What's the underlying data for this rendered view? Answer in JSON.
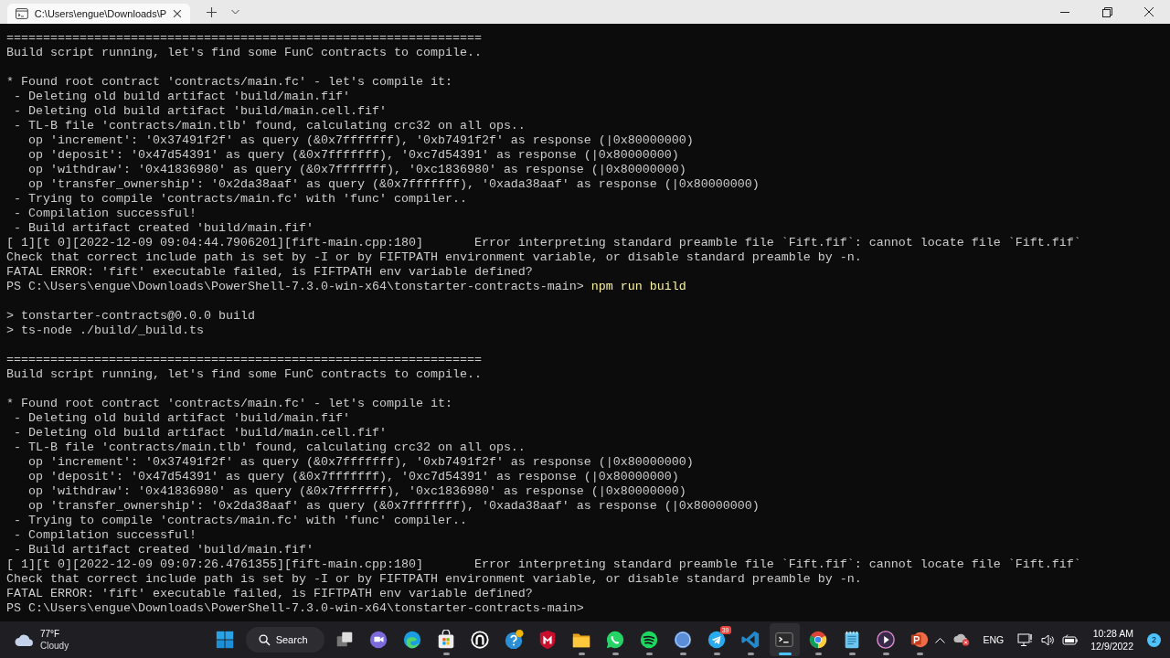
{
  "window": {
    "tab_title": "C:\\Users\\engue\\Downloads\\P"
  },
  "terminal": {
    "lines": [
      {
        "kind": "text",
        "text": "================================================================="
      },
      {
        "kind": "text",
        "text": "Build script running, let's find some FunC contracts to compile.."
      },
      {
        "kind": "blank"
      },
      {
        "kind": "text",
        "text": "* Found root contract 'contracts/main.fc' - let's compile it:"
      },
      {
        "kind": "text",
        "text": " - Deleting old build artifact 'build/main.fif'"
      },
      {
        "kind": "text",
        "text": " - Deleting old build artifact 'build/main.cell.fif'"
      },
      {
        "kind": "text",
        "text": " - TL-B file 'contracts/main.tlb' found, calculating crc32 on all ops.."
      },
      {
        "kind": "text",
        "text": "   op 'increment': '0x37491f2f' as query (&0x7fffffff), '0xb7491f2f' as response (|0x80000000)"
      },
      {
        "kind": "text",
        "text": "   op 'deposit': '0x47d54391' as query (&0x7fffffff), '0xc7d54391' as response (|0x80000000)"
      },
      {
        "kind": "text",
        "text": "   op 'withdraw': '0x41836980' as query (&0x7fffffff), '0xc1836980' as response (|0x80000000)"
      },
      {
        "kind": "text",
        "text": "   op 'transfer_ownership': '0x2da38aaf' as query (&0x7fffffff), '0xada38aaf' as response (|0x80000000)"
      },
      {
        "kind": "text",
        "text": " - Trying to compile 'contracts/main.fc' with 'func' compiler.."
      },
      {
        "kind": "text",
        "text": " - Compilation successful!"
      },
      {
        "kind": "text",
        "text": " - Build artifact created 'build/main.fif'"
      },
      {
        "kind": "text",
        "text": "[ 1][t 0][2022-12-09 09:04:44.7906201][fift-main.cpp:180]       Error interpreting standard preamble file `Fift.fif`: cannot locate file `Fift.fif`"
      },
      {
        "kind": "text",
        "text": "Check that correct include path is set by -I or by FIFTPATH environment variable, or disable standard preamble by -n."
      },
      {
        "kind": "text",
        "text": "FATAL ERROR: 'fift' executable failed, is FIFTPATH env variable defined?"
      },
      {
        "kind": "prompt",
        "prompt": "PS C:\\Users\\engue\\Downloads\\PowerShell-7.3.0-win-x64\\tonstarter-contracts-main>",
        "command": "npm run build"
      },
      {
        "kind": "blank"
      },
      {
        "kind": "text",
        "text": "> tonstarter-contracts@0.0.0 build"
      },
      {
        "kind": "text",
        "text": "> ts-node ./build/_build.ts"
      },
      {
        "kind": "blank"
      },
      {
        "kind": "text",
        "text": "================================================================="
      },
      {
        "kind": "text",
        "text": "Build script running, let's find some FunC contracts to compile.."
      },
      {
        "kind": "blank"
      },
      {
        "kind": "text",
        "text": "* Found root contract 'contracts/main.fc' - let's compile it:"
      },
      {
        "kind": "text",
        "text": " - Deleting old build artifact 'build/main.fif'"
      },
      {
        "kind": "text",
        "text": " - Deleting old build artifact 'build/main.cell.fif'"
      },
      {
        "kind": "text",
        "text": " - TL-B file 'contracts/main.tlb' found, calculating crc32 on all ops.."
      },
      {
        "kind": "text",
        "text": "   op 'increment': '0x37491f2f' as query (&0x7fffffff), '0xb7491f2f' as response (|0x80000000)"
      },
      {
        "kind": "text",
        "text": "   op 'deposit': '0x47d54391' as query (&0x7fffffff), '0xc7d54391' as response (|0x80000000)"
      },
      {
        "kind": "text",
        "text": "   op 'withdraw': '0x41836980' as query (&0x7fffffff), '0xc1836980' as response (|0x80000000)"
      },
      {
        "kind": "text",
        "text": "   op 'transfer_ownership': '0x2da38aaf' as query (&0x7fffffff), '0xada38aaf' as response (|0x80000000)"
      },
      {
        "kind": "text",
        "text": " - Trying to compile 'contracts/main.fc' with 'func' compiler.."
      },
      {
        "kind": "text",
        "text": " - Compilation successful!"
      },
      {
        "kind": "text",
        "text": " - Build artifact created 'build/main.fif'"
      },
      {
        "kind": "text",
        "text": "[ 1][t 0][2022-12-09 09:07:26.4761355][fift-main.cpp:180]       Error interpreting standard preamble file `Fift.fif`: cannot locate file `Fift.fif`"
      },
      {
        "kind": "text",
        "text": "Check that correct include path is set by -I or by FIFTPATH environment variable, or disable standard preamble by -n."
      },
      {
        "kind": "text",
        "text": "FATAL ERROR: 'fift' executable failed, is FIFTPATH env variable defined?"
      },
      {
        "kind": "prompt",
        "prompt": "PS C:\\Users\\engue\\Downloads\\PowerShell-7.3.0-win-x64\\tonstarter-contracts-main>"
      }
    ]
  },
  "taskbar": {
    "weather": {
      "temperature": "77°F",
      "condition": "Cloudy"
    },
    "search": {
      "label": "Search"
    },
    "apps": [
      {
        "kind": "start",
        "running": false,
        "active": false
      },
      {
        "kind": "search"
      },
      {
        "kind": "taskview",
        "running": false,
        "active": false
      },
      {
        "kind": "chat",
        "running": false,
        "active": false
      },
      {
        "kind": "edge",
        "running": false,
        "active": false
      },
      {
        "kind": "store",
        "running": true,
        "active": false
      },
      {
        "kind": "circle",
        "running": false,
        "active": false
      },
      {
        "kind": "help",
        "running": false,
        "active": false
      },
      {
        "kind": "shield",
        "running": false,
        "active": false
      },
      {
        "kind": "folder",
        "running": true,
        "active": false
      },
      {
        "kind": "whatsapp",
        "running": true,
        "active": false
      },
      {
        "kind": "spotify",
        "running": true,
        "active": false
      },
      {
        "kind": "qb",
        "running": true,
        "active": false
      },
      {
        "kind": "telegram",
        "running": true,
        "active": false,
        "badge": "39"
      },
      {
        "kind": "vscode",
        "running": true,
        "active": false
      },
      {
        "kind": "terminal",
        "running": true,
        "active": true
      },
      {
        "kind": "chrome",
        "running": true,
        "active": false
      },
      {
        "kind": "notepad",
        "running": true,
        "active": false
      },
      {
        "kind": "media",
        "running": true,
        "active": false
      },
      {
        "kind": "slides",
        "running": true,
        "active": false
      }
    ],
    "tray": {
      "language": "ENG",
      "time": "10:28 AM",
      "date": "12/9/2022",
      "notifications": "2"
    }
  }
}
